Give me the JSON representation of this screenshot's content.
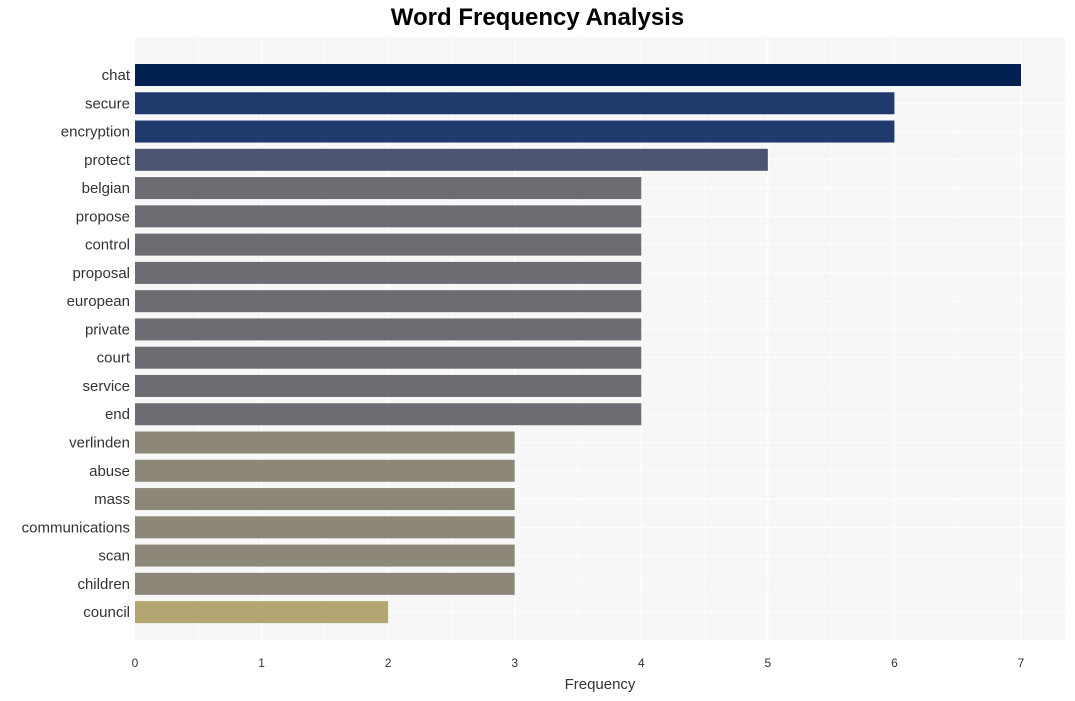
{
  "chart_data": {
    "type": "bar",
    "orientation": "horizontal",
    "title": "Word Frequency Analysis",
    "xlabel": "Frequency",
    "ylabel": "",
    "xlim": [
      0,
      7.35
    ],
    "xticks": [
      "0",
      "1",
      "2",
      "3",
      "4",
      "5",
      "6",
      "7"
    ],
    "grid": true,
    "categories": [
      "chat",
      "secure",
      "encryption",
      "protect",
      "belgian",
      "propose",
      "control",
      "proposal",
      "european",
      "private",
      "court",
      "service",
      "end",
      "verlinden",
      "abuse",
      "mass",
      "communications",
      "scan",
      "children",
      "council"
    ],
    "values": [
      7,
      6,
      6,
      5,
      4,
      4,
      4,
      4,
      4,
      4,
      4,
      4,
      4,
      3,
      3,
      3,
      3,
      3,
      3,
      2
    ],
    "colors": {
      "7": "#00214f",
      "6": "#213a6e",
      "5": "#4b5570",
      "4": "#6c6d72",
      "3": "#8c8778",
      "2": "#b3a672"
    },
    "background": "#f7f7f7"
  }
}
